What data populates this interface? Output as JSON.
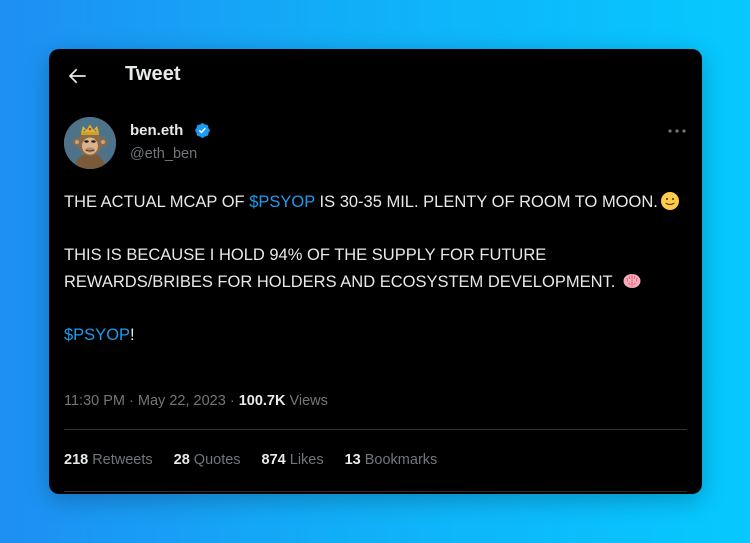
{
  "header": {
    "title": "Tweet",
    "back_icon": "arrow-left-icon"
  },
  "author": {
    "display_name": "ben.eth",
    "handle": "@eth_ben",
    "verified": true,
    "verified_color": "#1d9bf0",
    "avatar": "bored-ape-avatar"
  },
  "more_icon": "more-dots-icon",
  "tweet": {
    "line1_pre": "THE ACTUAL MCAP OF ",
    "line1_cashtag": "$PSYOP",
    "line1_post": " IS 30-35 MIL. PLENTY OF ROOM TO MOON.",
    "line1_emoji": "slightly-smiling-face-emoji",
    "line2": "THIS IS BECAUSE I HOLD 94% OF THE SUPPLY FOR FUTURE REWARDS/BRIBES FOR HOLDERS AND ECOSYSTEM DEVELOPMENT.",
    "line2_emoji": "brain-emoji",
    "line3_cashtag": "$PSYOP",
    "line3_post": "!"
  },
  "meta": {
    "time": "11:30 PM",
    "separator": "·",
    "date": "May 22, 2023",
    "views_count": "100.7K",
    "views_label": "Views"
  },
  "stats": {
    "retweets_count": "218",
    "retweets_label": "Retweets",
    "quotes_count": "28",
    "quotes_label": "Quotes",
    "likes_count": "874",
    "likes_label": "Likes",
    "bookmarks_count": "13",
    "bookmarks_label": "Bookmarks"
  },
  "colors": {
    "accent": "#1d9bf0",
    "background_card": "#000000",
    "text_primary": "#e7e9ea",
    "text_secondary": "#71767b"
  }
}
